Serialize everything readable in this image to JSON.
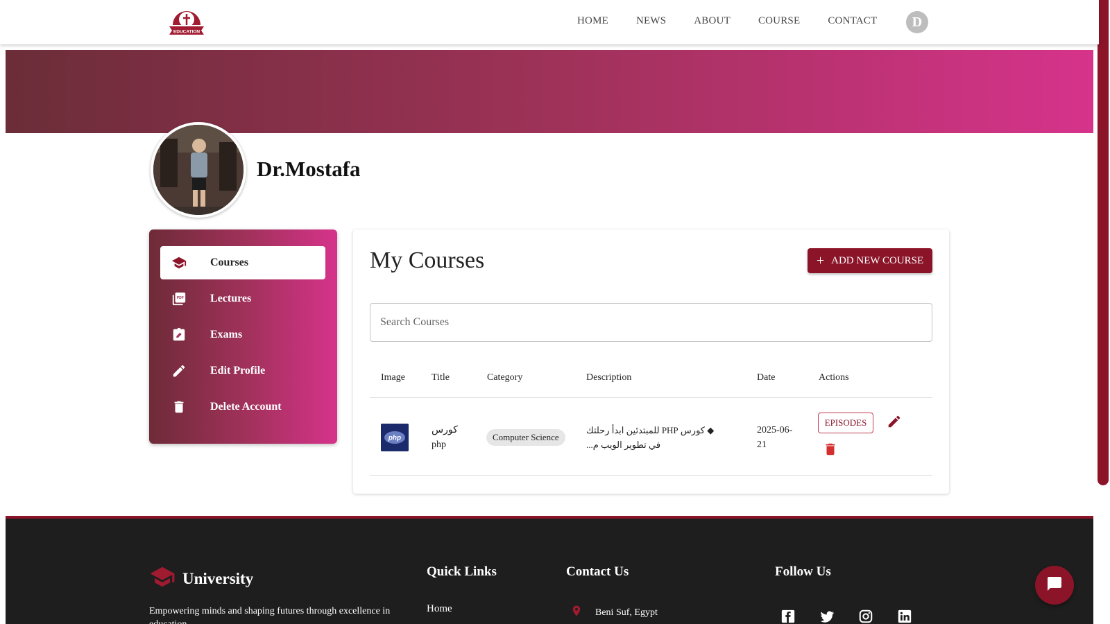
{
  "navbar": {
    "logo_text": "EDUCATION",
    "links": [
      "HOME",
      "NEWS",
      "ABOUT",
      "COURSE",
      "CONTACT"
    ],
    "avatar_initial": "D"
  },
  "profile": {
    "name": "Dr.Mostafa"
  },
  "sidebar": {
    "items": [
      {
        "label": "Courses",
        "icon": "graduation-cap-icon",
        "active": true
      },
      {
        "label": "Lectures",
        "icon": "pdf-icon",
        "active": false
      },
      {
        "label": "Exams",
        "icon": "assignment-icon",
        "active": false
      },
      {
        "label": "Edit Profile",
        "icon": "pencil-icon",
        "active": false
      },
      {
        "label": "Delete Account",
        "icon": "trash-icon",
        "active": false
      }
    ]
  },
  "main": {
    "title": "My Courses",
    "add_button_label": "ADD NEW COURSE",
    "search_placeholder": "Search Courses",
    "table": {
      "headers": [
        "Image",
        "Title",
        "Category",
        "Description",
        "Date",
        "Actions"
      ],
      "rows": [
        {
          "image_label": "php",
          "title": "كورس php",
          "category": "Computer Science",
          "description": "◆ كورس PHP للمبتدئين ابدأ رحلتك في تطوير الويب م...",
          "date": "2025-06-21",
          "episodes_label": "EPISODES"
        }
      ]
    }
  },
  "footer": {
    "brand": "University",
    "tagline": "Empowering minds and shaping futures through excellence in education",
    "quick_links_heading": "Quick Links",
    "quick_links": [
      "Home"
    ],
    "contact_heading": "Contact Us",
    "contact_location": "Beni Suf, Egypt",
    "follow_heading": "Follow Us",
    "social": [
      "facebook-icon",
      "twitter-icon",
      "instagram-icon",
      "linkedin-icon"
    ]
  },
  "colors": {
    "accent": "#8b1429",
    "banner_start": "#6b2d38",
    "banner_end": "#d6338b",
    "footer_bg": "#1e1e1e"
  }
}
